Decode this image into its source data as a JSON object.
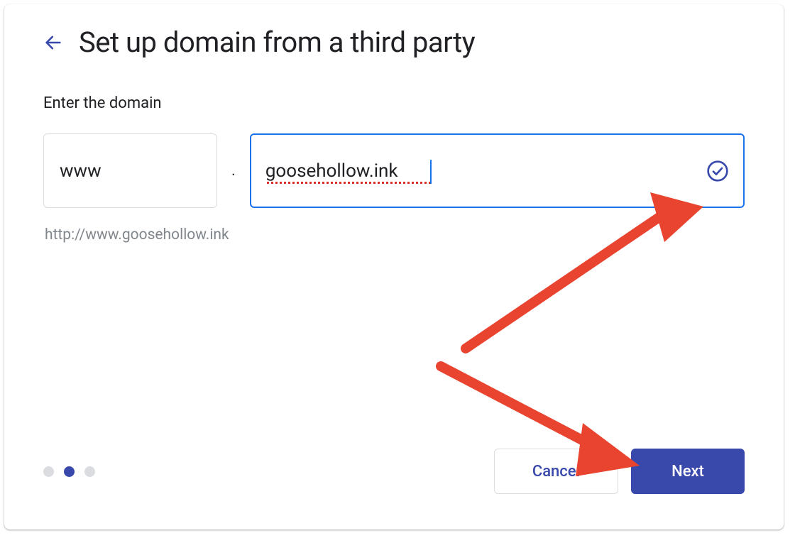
{
  "header": {
    "title": "Set up domain from a third party"
  },
  "form": {
    "label": "Enter the domain",
    "subdomain_value": "www",
    "separator": ".",
    "domain_value": "goosehollow.ink",
    "preview_url": "http://www.goosehollow.ink"
  },
  "progress": {
    "total": 3,
    "active_index": 1
  },
  "buttons": {
    "cancel_label": "Cancel",
    "next_label": "Next"
  },
  "colors": {
    "primary": "#3949ab",
    "focus_blue": "#1a73e8",
    "arrow_red": "#e8442f",
    "text_dark": "#202124",
    "text_muted": "#80868b",
    "border_light": "#dadce0"
  }
}
